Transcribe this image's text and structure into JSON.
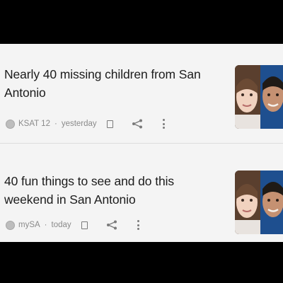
{
  "feed": {
    "items": [
      {
        "title": "Nearly 40 missing children from San Antonio",
        "source": "KSAT 12",
        "separator": "·",
        "time": "yesterday"
      },
      {
        "title": "40 fun things to see and do this weekend in San Antonio",
        "source": "mySA",
        "separator": "·",
        "time": "today"
      }
    ]
  },
  "colors": {
    "background": "#000000",
    "card": "#f4f4f4",
    "title": "#1c1c1c",
    "meta": "#8a8a8a",
    "thumb_blue": "#1e4f8f"
  },
  "icons": {
    "source": "source-logo-icon",
    "bookmark": "bookmark-icon",
    "share": "share-icon",
    "more": "more-vert-icon"
  }
}
